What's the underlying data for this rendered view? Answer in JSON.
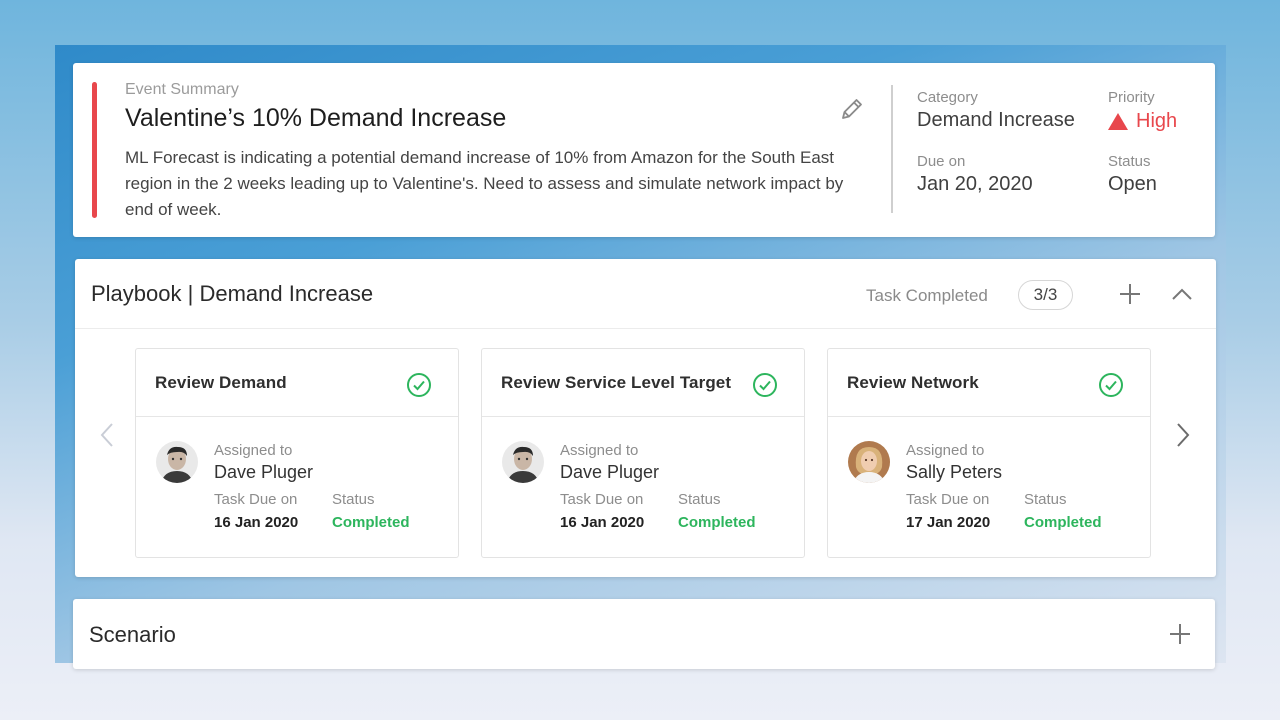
{
  "event": {
    "eyebrow": "Event Summary",
    "title": "Valentine’s 10% Demand Increase",
    "description": "ML Forecast is indicating a potential demand increase of 10% from Amazon for the South East region in the 2 weeks leading up to Valentine's. Need to assess and simulate network impact by end of week.",
    "category_label": "Category",
    "category_value": "Demand Increase",
    "priority_label": "Priority",
    "priority_value": "High",
    "due_label": "Due on",
    "due_value": "Jan 20, 2020",
    "status_label": "Status",
    "status_value": "Open",
    "accent_color": "#e8474c",
    "edit_icon": "pencil-icon"
  },
  "playbook": {
    "title": "Playbook | Demand Increase",
    "task_completed_label": "Task Completed",
    "task_count": "3/3",
    "add_icon": "plus-icon",
    "collapse_icon": "chevron-up-icon",
    "prev_icon": "chevron-left-icon",
    "next_icon": "chevron-right-icon",
    "tasks": [
      {
        "title": "Review Demand",
        "assigned_label": "Assigned to",
        "assignee": "Dave Pluger",
        "due_label": "Task Due on",
        "due": "16 Jan 2020",
        "status_label": "Status",
        "status": "Completed"
      },
      {
        "title": "Review Service Level Target",
        "assigned_label": "Assigned to",
        "assignee": "Dave Pluger",
        "due_label": "Task Due on",
        "due": "16 Jan 2020",
        "status_label": "Status",
        "status": "Completed"
      },
      {
        "title": "Review Network",
        "assigned_label": "Assigned to",
        "assignee": "Sally Peters",
        "due_label": "Task Due on",
        "due": "17 Jan 2020",
        "status_label": "Status",
        "status": "Completed"
      }
    ],
    "completed_color": "#2db55d"
  },
  "scenario": {
    "title": "Scenario",
    "add_icon": "plus-icon"
  }
}
